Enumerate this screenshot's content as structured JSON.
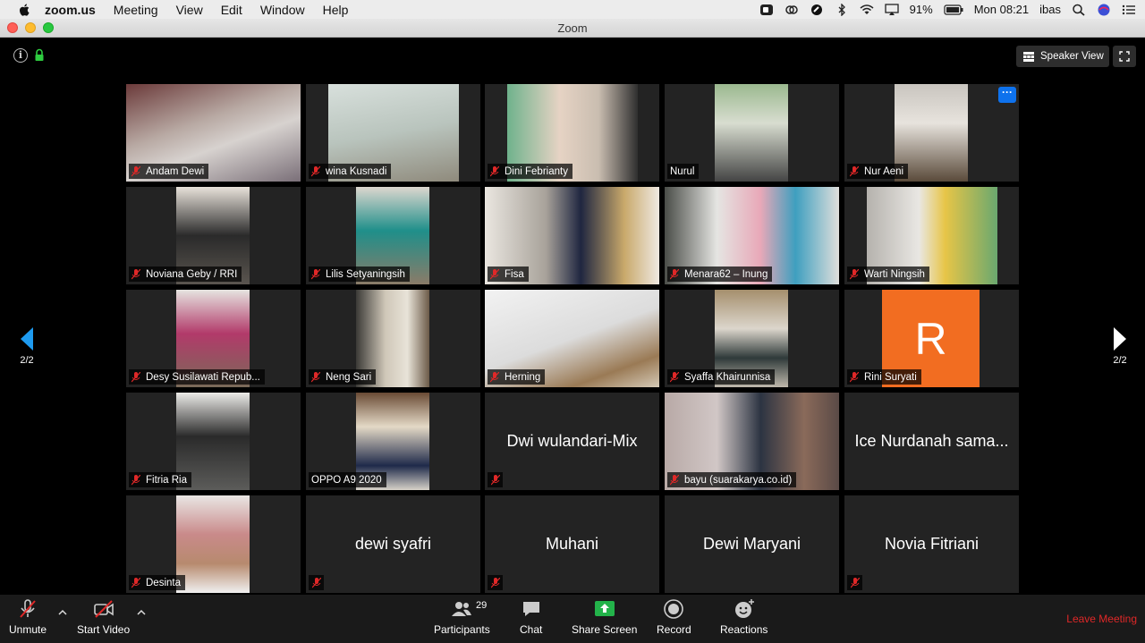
{
  "menubar": {
    "app_name": "zoom.us",
    "items": [
      "Meeting",
      "View",
      "Edit",
      "Window",
      "Help"
    ],
    "battery": "91%",
    "clock": "Mon 08:21",
    "user": "ibas"
  },
  "window": {
    "title": "Zoom"
  },
  "view_toggle": {
    "label": "Speaker View"
  },
  "pager": {
    "left": "2/2",
    "right": "2/2"
  },
  "tiles": [
    {
      "name": "Andam Dewi"
    },
    {
      "name": "wina Kusnadi"
    },
    {
      "name": "Dini Febrianty"
    },
    {
      "name": "Nurul"
    },
    {
      "name": "Nur Aeni"
    },
    {
      "name": "Noviana Geby / RRI"
    },
    {
      "name": "Lilis Setyaningsih"
    },
    {
      "name": "Fisa"
    },
    {
      "name": "Menara62 – Inung"
    },
    {
      "name": "Warti Ningsih"
    },
    {
      "name": "Desy Susilawati Repub..."
    },
    {
      "name": "Neng Sari"
    },
    {
      "name": "Herning"
    },
    {
      "name": "Syaffa Khairunnisa"
    },
    {
      "name": "Rini Suryati",
      "avatar_letter": "R"
    },
    {
      "name": "Fitria Ria"
    },
    {
      "name": "OPPO A9 2020"
    },
    {
      "name": "Dwi wulandari-Mix"
    },
    {
      "name": "bayu (suarakarya.co.id)"
    },
    {
      "name": "Ice Nurdanah sama..."
    },
    {
      "name": "Desinta"
    },
    {
      "name": "dewi syafri"
    },
    {
      "name": "Muhani"
    },
    {
      "name": "Dewi Maryani"
    },
    {
      "name": "Novia Fitriani"
    }
  ],
  "toolbar": {
    "unmute": "Unmute",
    "start_video": "Start Video",
    "participants": "Participants",
    "participants_count": "29",
    "chat": "Chat",
    "share_screen": "Share Screen",
    "record": "Record",
    "reactions": "Reactions",
    "leave": "Leave Meeting"
  },
  "colors": {
    "share_green": "#23b34a",
    "leave_red": "#e02828",
    "avatar_orange": "#f26d21",
    "more_blue": "#0e72ed"
  }
}
